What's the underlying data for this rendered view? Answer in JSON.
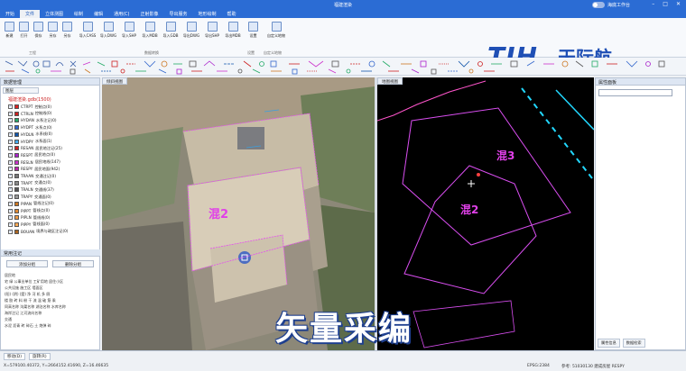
{
  "title": "福建渲染",
  "toggle_label": "海底工作台",
  "menus": [
    "开始",
    "文件",
    "立体测图",
    "绘制",
    "编辑",
    "通用(C)",
    "正射影像",
    "导出服务",
    "地形绘制",
    "帮助"
  ],
  "ribbon": {
    "buttons": [
      "新建",
      "打开",
      "保存",
      "另存",
      "另存",
      "导入CASS",
      "导入DWG",
      "导入SHP",
      "导入MDB",
      "导入GDB",
      "导出DWG",
      "导出SHP",
      "导出MDB",
      "设置",
      "自定义地物"
    ],
    "groups": [
      "工程",
      "数据转换",
      "设置",
      "自定义地物"
    ]
  },
  "logo": {
    "brand": "TJH",
    "name": "天际航",
    "tagline": "INFORMATION SCIENCE&TECHNOLOGY"
  },
  "left_panel": {
    "title": "数据管理",
    "tab": "图层",
    "root": "福建渲染.gdb(1500)",
    "layers": [
      {
        "code": "CTRPT",
        "name": "控制点(0)",
        "color": "#d22"
      },
      {
        "code": "CTRLN",
        "name": "控制线(0)",
        "color": "#c22"
      },
      {
        "code": "HYDAN",
        "name": "水系注记(0)",
        "color": "#2a6"
      },
      {
        "code": "HYDPT",
        "name": "水系点(0)",
        "color": "#36c"
      },
      {
        "code": "HYDLN",
        "name": "水系线(0)",
        "color": "#15a"
      },
      {
        "code": "HYDPY",
        "name": "水系面(1)",
        "color": "#4ae"
      },
      {
        "code": "RESAN",
        "name": "居民地注记(25)",
        "color": "#c22"
      },
      {
        "code": "RESPT",
        "name": "居民地点(0)",
        "color": "#a2c"
      },
      {
        "code": "RESLN",
        "name": "居民地线(147)",
        "color": "#c3c"
      },
      {
        "code": "RESPY",
        "name": "居民地面(942)",
        "color": "#b2a"
      },
      {
        "code": "TRAAN",
        "name": "交通注记(0)",
        "color": "#777"
      },
      {
        "code": "TRAPT",
        "name": "交通点(0)",
        "color": "#888"
      },
      {
        "code": "TRALN",
        "name": "交通线(37)",
        "color": "#555"
      },
      {
        "code": "TRAPY",
        "name": "交通面(0)",
        "color": "#999"
      },
      {
        "code": "PIPAN",
        "name": "管线注记(0)",
        "color": "#c72"
      },
      {
        "code": "PIPPT",
        "name": "管线点(0)",
        "color": "#d83"
      },
      {
        "code": "PIPLN",
        "name": "管线线(0)",
        "color": "#e94"
      },
      {
        "code": "PIPPY",
        "name": "管线面(0)",
        "color": "#fa5"
      },
      {
        "code": "BOUAN",
        "name": "境界与政区注记(0)",
        "color": "#a62"
      }
    ],
    "qa_title": "常用注记",
    "btn_add": "添加分组",
    "btn_del": "删除分组",
    "qa_lines": [
      "居民地",
      "宅 绿 公事业单位 工矿用地 居住小区",
      "公共设施 施工区 墙面区",
      "(阳) (阴) (窟) 净 河 机 多 厕",
      "楼 胶 砖 料 粉 干 流 温 破 筋 乘",
      "同高名称 沟渠名称 湖泊名称 水库名称",
      "海岸注记 江河流向名称",
      "交通",
      "水泥 沥青 砖 碎石 土 炮弹 碎"
    ]
  },
  "views": {
    "left_tab": "倾斜视图",
    "right_tab": "地图视图"
  },
  "map_labels": {
    "left": "混2",
    "right_top": "混3",
    "right_bottom": "混2"
  },
  "right_panel": {
    "title": "属性面板",
    "tabs": [
      "属性信息",
      "数据检索"
    ]
  },
  "status": {
    "tabs": [
      "移动(D)",
      "旋转(R)"
    ],
    "coords": "X=579100.40372, Y=2664152.41690, Z=16.46635",
    "epsg": "EPSG:2384",
    "ref": "参考: 51030130 建成房屋 RESPY"
  },
  "overlay_text": "矢量采编"
}
